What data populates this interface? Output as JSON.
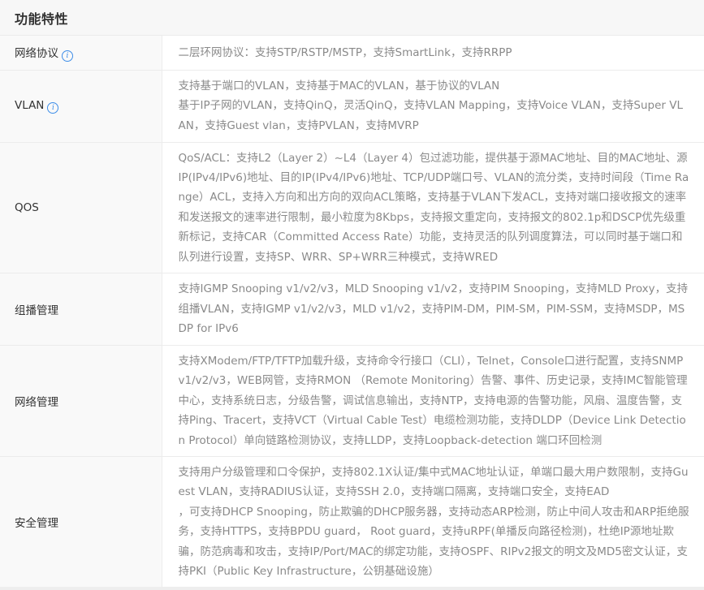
{
  "header": {
    "title": "功能特性"
  },
  "rows": [
    {
      "name": "网络协议",
      "lines": [
        "二层环网协议：支持STP/RSTP/MSTP，支持SmartLink，支持RRPP"
      ]
    },
    {
      "name": "VLAN",
      "lines": [
        "支持基于端口的VLAN，支持基于MAC的VLAN，基于协议的VLAN",
        "基于IP子网的VLAN，支持QinQ，灵活QinQ，支持VLAN Mapping，支持Voice VLAN，支持Super VLAN，支持Guest vlan，支持PVLAN，支持MVRP"
      ]
    },
    {
      "name": "QOS",
      "lines": [
        "QoS/ACL：支持L2（Layer 2）~L4（Layer 4）包过滤功能，提供基于源MAC地址、目的MAC地址、源IP(IPv4/IPv6)地址、目的IP(IPv4/IPv6)地址、TCP/UDP端口号、VLAN的流分类，支持时间段（Time Range）ACL，支持入方向和出方向的双向ACL策略，支持基于VLAN下发ACL，支持对端口接收报文的速率和发送报文的速率进行限制，最小粒度为8Kbps，支持报文重定向，支持报文的802.1p和DSCP优先级重新标记，支持CAR（Committed Access Rate）功能，支持灵活的队列调度算法，可以同时基于端口和队列进行设置，支持SP、WRR、SP+WRR三种模式，支持WRED"
      ]
    },
    {
      "name": "组播管理",
      "lines": [
        "支持IGMP Snooping v1/v2/v3，MLD Snooping v1/v2，支持PIM Snooping，支持MLD Proxy，支持组播VLAN，支持IGMP v1/v2/v3，MLD v1/v2，支持PIM-DM，PIM-SM，PIM-SSM，支持MSDP，MSDP for IPv6"
      ]
    },
    {
      "name": "网络管理",
      "lines": [
        "支持XModem/FTP/TFTP加载升级，支持命令行接口（CLI），Telnet，Console口进行配置，支持SNMPv1/v2/v3，WEB网管，支持RMON （Remote Monitoring）告警、事件、历史记录，支持IMC智能管理中心，支持系统日志，分级告警，调试信息输出，支持NTP，支持电源的告警功能，风扇、温度告警，支持Ping、Tracert，支持VCT（Virtual Cable Test）电缆检测功能，支持DLDP（Device Link Detection Protocol）单向链路检测协议，支持LLDP，支持Loopback-detection 端口环回检测"
      ]
    },
    {
      "name": "安全管理",
      "lines": [
        "支持用户分级管理和口令保护，支持802.1X认证/集中式MAC地址认证，单端口最大用户数限制，支持Guest VLAN，支持RADIUS认证，支持SSH 2.0，支持端口隔离，支持端口安全，支持EAD",
        "，可支持DHCP Snooping，防止欺骗的DHCP服务器，支持动态ARP检测，防止中间人攻击和ARP拒绝服务，支持HTTPS，支持BPDU guard， Root guard，支持uRPF(单播反向路径检测)，杜绝IP源地址欺骗，防范病毒和攻击，支持IP/Port/MAC的绑定功能，支持OSPF、RIPv2报文的明文及MD5密文认证，支持PKI（Public Key Infrastructure，公钥基础设施）"
      ]
    }
  ]
}
